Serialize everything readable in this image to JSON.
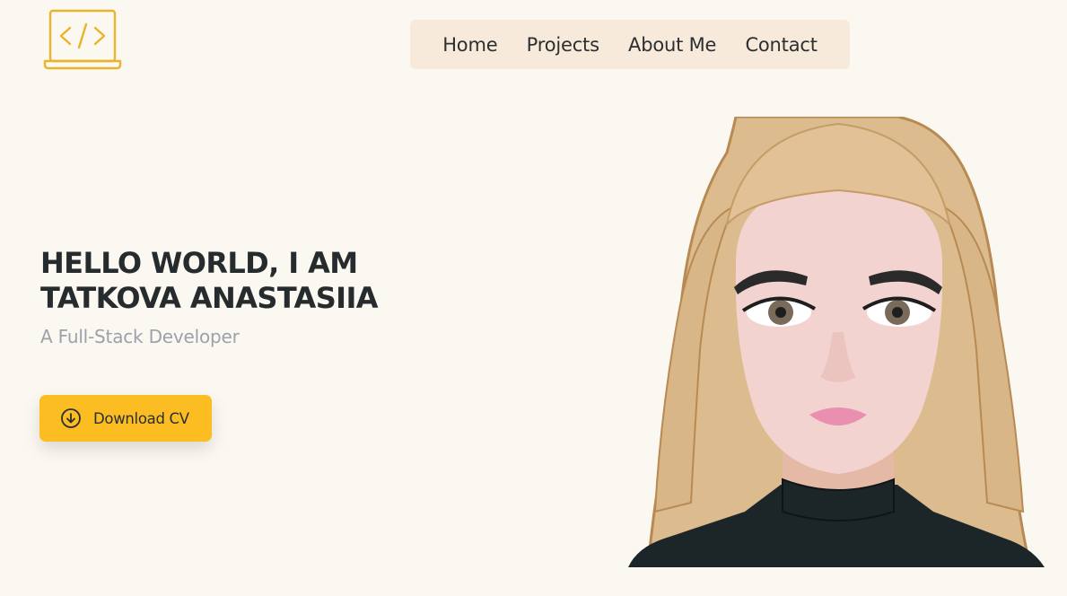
{
  "header": {
    "logo_icon": "laptop-code-icon",
    "nav": {
      "home": "Home",
      "projects": "Projects",
      "about": "About Me",
      "contact": "Contact"
    }
  },
  "hero": {
    "headline_line1": "HELLO WORLD, I AM",
    "headline_line2": "TATKOVA ANASTASIIA",
    "subtitle": "A Full-Stack Developer",
    "download_label": "Download CV",
    "download_icon": "arrow-down-circle-icon",
    "avatar": "cartoon-woman-avatar"
  },
  "colors": {
    "background": "#fbf7f1",
    "nav_background": "#f8eadb",
    "accent": "#fbbd22",
    "text": "#2b2f30",
    "muted": "#9ca2ab"
  }
}
